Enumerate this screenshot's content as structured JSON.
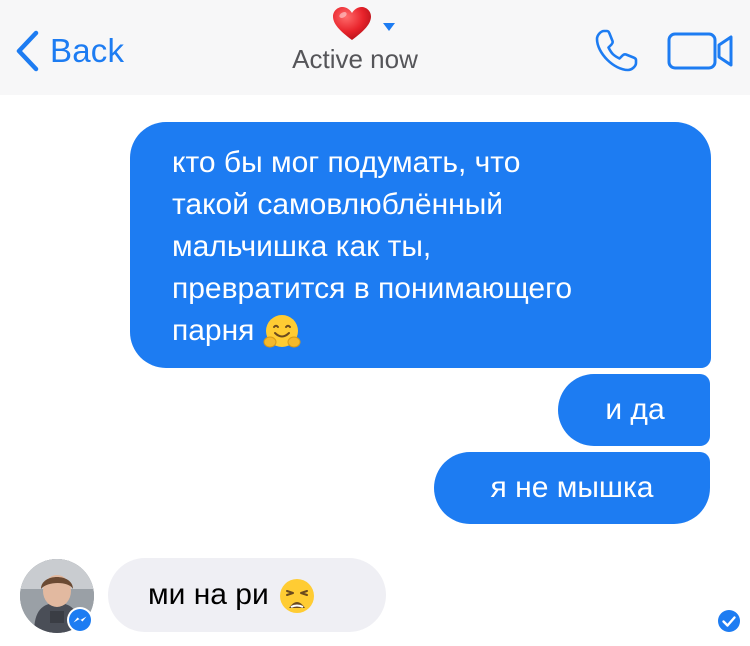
{
  "nav": {
    "back_label": "Back",
    "status": "Active now",
    "title_icon": "heart-emoji",
    "call_icon": "phone-icon",
    "video_icon": "video-camera-icon"
  },
  "messages": [
    {
      "from": "me",
      "lines": [
        "кто бы мог подумать, что",
        "такой самовлюблённый",
        "мальчишка как ты,",
        "превратится в понимающего",
        "парня"
      ],
      "emoji": "hugging-face-emoji"
    },
    {
      "from": "me",
      "text": "и да"
    },
    {
      "from": "me",
      "text": "я не мышка"
    },
    {
      "from": "them",
      "text": "ми на ри",
      "emoji": "weary-face-emoji"
    }
  ],
  "colors": {
    "accent": "#1d7cf2",
    "incoming_bubble": "#efeff4",
    "nav_bg": "#f7f7f8"
  }
}
